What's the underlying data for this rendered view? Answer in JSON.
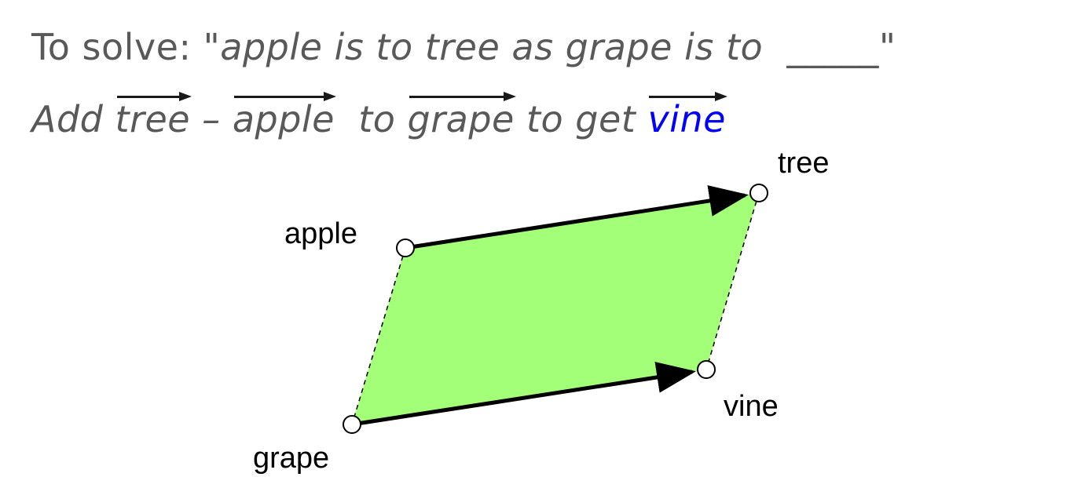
{
  "heading": {
    "prefix": "To solve: ",
    "question": "\"apple is to tree as grape is to  _____\""
  },
  "instruction": {
    "add": "Add ",
    "vec_tree": "tree",
    "minus": " – ",
    "vec_apple": "apple",
    "to": "  to ",
    "vec_grape": "grape",
    "to_get": " to get ",
    "vec_vine": "vine"
  },
  "diagram": {
    "labels": {
      "apple": "apple",
      "tree": "tree",
      "grape": "grape",
      "vine": "vine"
    },
    "colors": {
      "fill": "#a3ff78",
      "arrow": "#000000",
      "node_fill": "#ffffff",
      "node_stroke": "#000000",
      "dashed": "#000000",
      "text_gray": "#595959",
      "highlight_blue": "#0000ff"
    }
  }
}
